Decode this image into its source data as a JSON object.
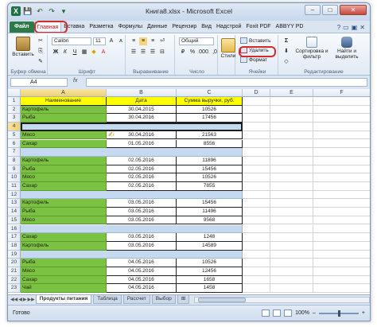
{
  "window": {
    "title": "Книга8.xlsx - Microsoft Excel",
    "controls": {
      "minimize": "–",
      "maximize": "□",
      "close": "✕"
    }
  },
  "qat": {
    "app_icon": "X",
    "save_icon": "💾",
    "undo_icon": "↶",
    "redo_icon": "↷",
    "customize_icon": "▾"
  },
  "tabs": [
    {
      "label": "Файл"
    },
    {
      "label": "Главная"
    },
    {
      "label": "Вставка"
    },
    {
      "label": "Разметка"
    },
    {
      "label": "Формулы"
    },
    {
      "label": "Данные"
    },
    {
      "label": "Рецензир"
    },
    {
      "label": "Вид"
    },
    {
      "label": "Надстрой"
    },
    {
      "label": "Foxit PDF"
    },
    {
      "label": "ABBYY PD"
    }
  ],
  "tabs_right": {
    "help": "?",
    "min": "▭",
    "restore": "▣",
    "close": "✕"
  },
  "ribbon": {
    "clipboard": {
      "paste_label": "Вставить",
      "group_label": "Буфер обмена"
    },
    "font": {
      "font_name": "Calibri",
      "font_size": "11",
      "bold": "Ж",
      "italic": "К",
      "underline": "Ч",
      "grow": "A",
      "shrink": "A",
      "group_label": "Шрифт"
    },
    "alignment": {
      "group_label": "Выравнивание"
    },
    "number": {
      "format": "Общий",
      "currency": "%",
      "percent": "000",
      "group_label": "Число"
    },
    "styles": {
      "label": "Стили"
    },
    "cells": {
      "insert": "Вставить",
      "delete": "Удалить",
      "format": "Формат",
      "group_label": "Ячейки"
    },
    "editing": {
      "sum": "Σ",
      "sort_filter": "Сортировка и фильтр",
      "find_select": "Найти и выделить",
      "group_label": "Редактирование"
    }
  },
  "formula_bar": {
    "name_box": "A4",
    "fx": "fx",
    "value": ""
  },
  "columns": [
    "A",
    "B",
    "C",
    "D",
    "E",
    "F"
  ],
  "headers": {
    "name": "Наименование",
    "date": "Дата",
    "sum": "Сумма выручки, руб."
  },
  "rows": [
    {
      "n": "1",
      "name": "Наименование",
      "date": "Дата",
      "sum": "Сумма выручки, руб.",
      "type": "header"
    },
    {
      "n": "2",
      "name": "Картофель",
      "date": "30.04.2015",
      "sum": "10526",
      "type": "data"
    },
    {
      "n": "3",
      "name": "Рыба",
      "date": "30.04.2016",
      "sum": "17456",
      "type": "data"
    },
    {
      "n": "4",
      "name": "",
      "date": "",
      "sum": "",
      "type": "blank"
    },
    {
      "n": "5",
      "name": "Мясо",
      "date": "30.04.2016",
      "sum": "21563",
      "type": "data"
    },
    {
      "n": "6",
      "name": "Сахар",
      "date": "01.05.2016",
      "sum": "8556",
      "type": "data"
    },
    {
      "n": "7",
      "name": "",
      "date": "",
      "sum": "",
      "type": "blank"
    },
    {
      "n": "8",
      "name": "Картофель",
      "date": "02.05.2016",
      "sum": "11896",
      "type": "data"
    },
    {
      "n": "9",
      "name": "Рыба",
      "date": "02.05.2016",
      "sum": "15456",
      "type": "data"
    },
    {
      "n": "10",
      "name": "Мясо",
      "date": "02.05.2016",
      "sum": "10526",
      "type": "data"
    },
    {
      "n": "11",
      "name": "Сахар",
      "date": "02.05.2016",
      "sum": "7855",
      "type": "data"
    },
    {
      "n": "12",
      "name": "",
      "date": "",
      "sum": "",
      "type": "blank"
    },
    {
      "n": "13",
      "name": "Картофель",
      "date": "03.05.2016",
      "sum": "15456",
      "type": "data"
    },
    {
      "n": "14",
      "name": "Рыба",
      "date": "03.05.2016",
      "sum": "11496",
      "type": "data"
    },
    {
      "n": "15",
      "name": "Мясо",
      "date": "03.05.2016",
      "sum": "9568",
      "type": "data"
    },
    {
      "n": "16",
      "name": "",
      "date": "",
      "sum": "",
      "type": "blank"
    },
    {
      "n": "17",
      "name": "Сахар",
      "date": "03.05.2016",
      "sum": "1248",
      "type": "data"
    },
    {
      "n": "18",
      "name": "Картофель",
      "date": "03.05.2016",
      "sum": "14589",
      "type": "data"
    },
    {
      "n": "19",
      "name": "",
      "date": "",
      "sum": "",
      "type": "blank"
    },
    {
      "n": "20",
      "name": "Рыба",
      "date": "04.05.2016",
      "sum": "10526",
      "type": "data"
    },
    {
      "n": "21",
      "name": "Мясо",
      "date": "04.05.2016",
      "sum": "12456",
      "type": "data"
    },
    {
      "n": "22",
      "name": "Сахар",
      "date": "04.05.2016",
      "sum": "1658",
      "type": "data"
    },
    {
      "n": "23",
      "name": "Чай",
      "date": "04.05.2016",
      "sum": "1458",
      "type": "data"
    }
  ],
  "sheets": [
    {
      "label": "Продукты питания",
      "active": true
    },
    {
      "label": "Таблица",
      "active": false
    },
    {
      "label": "Рассчет",
      "active": false
    },
    {
      "label": "Выбор",
      "active": false
    }
  ],
  "sheet_nav": {
    "first": "◀◀",
    "prev": "◀",
    "next": "▶",
    "last": "▶▶",
    "new_sheet": "⊞"
  },
  "status": {
    "ready": "Готово",
    "zoom": "100%",
    "zoom_minus": "–",
    "zoom_plus": "+"
  },
  "colors": {
    "green": "#7cc242",
    "yellow": "#ffff00",
    "blank_row": "#c5d9f1",
    "highlight_ring": "#d42c2c"
  }
}
